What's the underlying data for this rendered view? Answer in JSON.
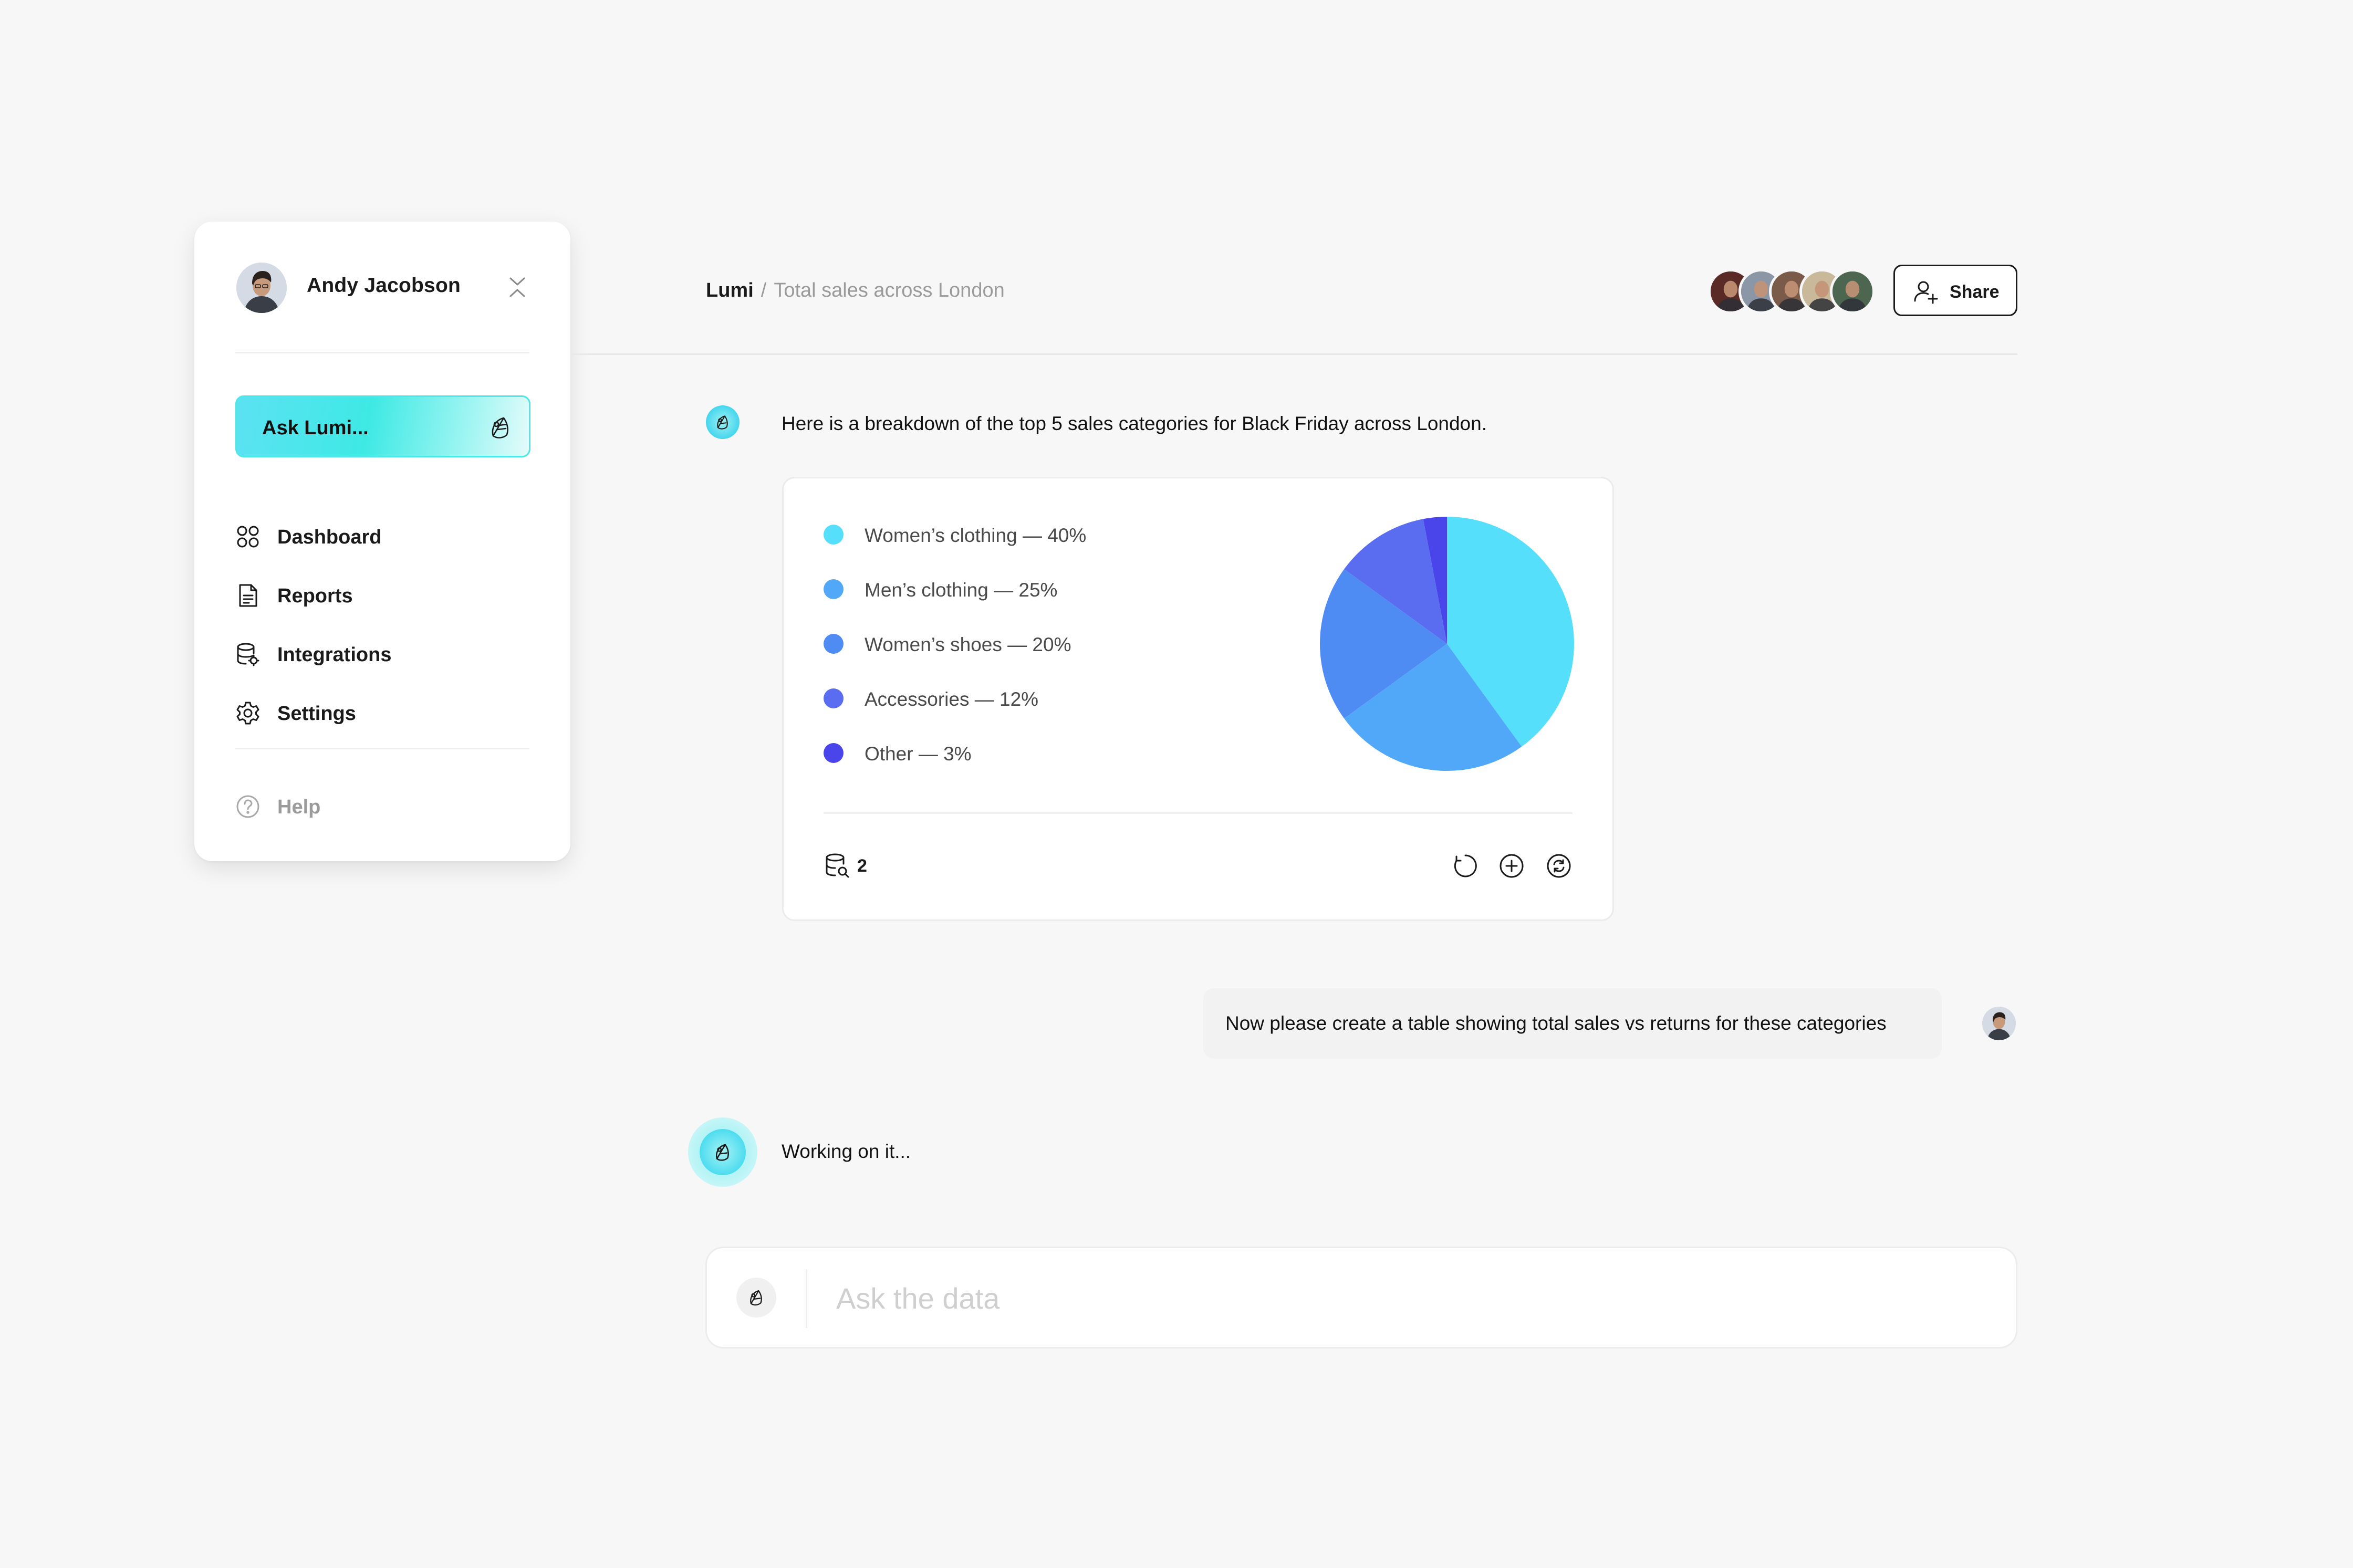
{
  "sidebar": {
    "user_name": "Andy Jacobson",
    "ask_label": "Ask Lumi...",
    "nav": [
      {
        "label": "Dashboard",
        "icon": "grid-icon"
      },
      {
        "label": "Reports",
        "icon": "document-icon"
      },
      {
        "label": "Integrations",
        "icon": "database-icon"
      },
      {
        "label": "Settings",
        "icon": "gear-icon"
      }
    ],
    "help_label": "Help"
  },
  "header": {
    "breadcrumb_root": "Lumi",
    "breadcrumb_separator": "/",
    "breadcrumb_current": "Total sales across London",
    "share_label": "Share",
    "collaborator_colors": [
      "#5a2a26",
      "#8b97a6",
      "#7a5a48",
      "#c9b89a",
      "#4c6650"
    ]
  },
  "chat": {
    "bot_message": "Here is a breakdown of the top 5 sales categories for Black Friday across London.",
    "user_message": "Now please create a table showing total sales vs returns for these categories",
    "working_text": "Working on it..."
  },
  "chart_card": {
    "legend": [
      {
        "text": "Women’s clothing — 40%",
        "color": "#56dffb"
      },
      {
        "text": "Men’s clothing — 25%",
        "color": "#52a8f8"
      },
      {
        "text": "Women’s shoes — 20%",
        "color": "#4e8bf3"
      },
      {
        "text": "Accessories — 12%",
        "color": "#5a6cf0"
      },
      {
        "text": "Other — 3%",
        "color": "#4a45ea"
      }
    ],
    "source_count": "2"
  },
  "chart_data": {
    "type": "pie",
    "categories": [
      "Women’s clothing",
      "Men’s clothing",
      "Women’s shoes",
      "Accessories",
      "Other"
    ],
    "values": [
      40,
      25,
      20,
      12,
      3
    ],
    "colors": [
      "#56dffb",
      "#52a8f8",
      "#4e8bf3",
      "#5a6cf0",
      "#4a45ea"
    ],
    "unit": "%",
    "legend_position": "left"
  },
  "input": {
    "placeholder": "Ask the data"
  }
}
